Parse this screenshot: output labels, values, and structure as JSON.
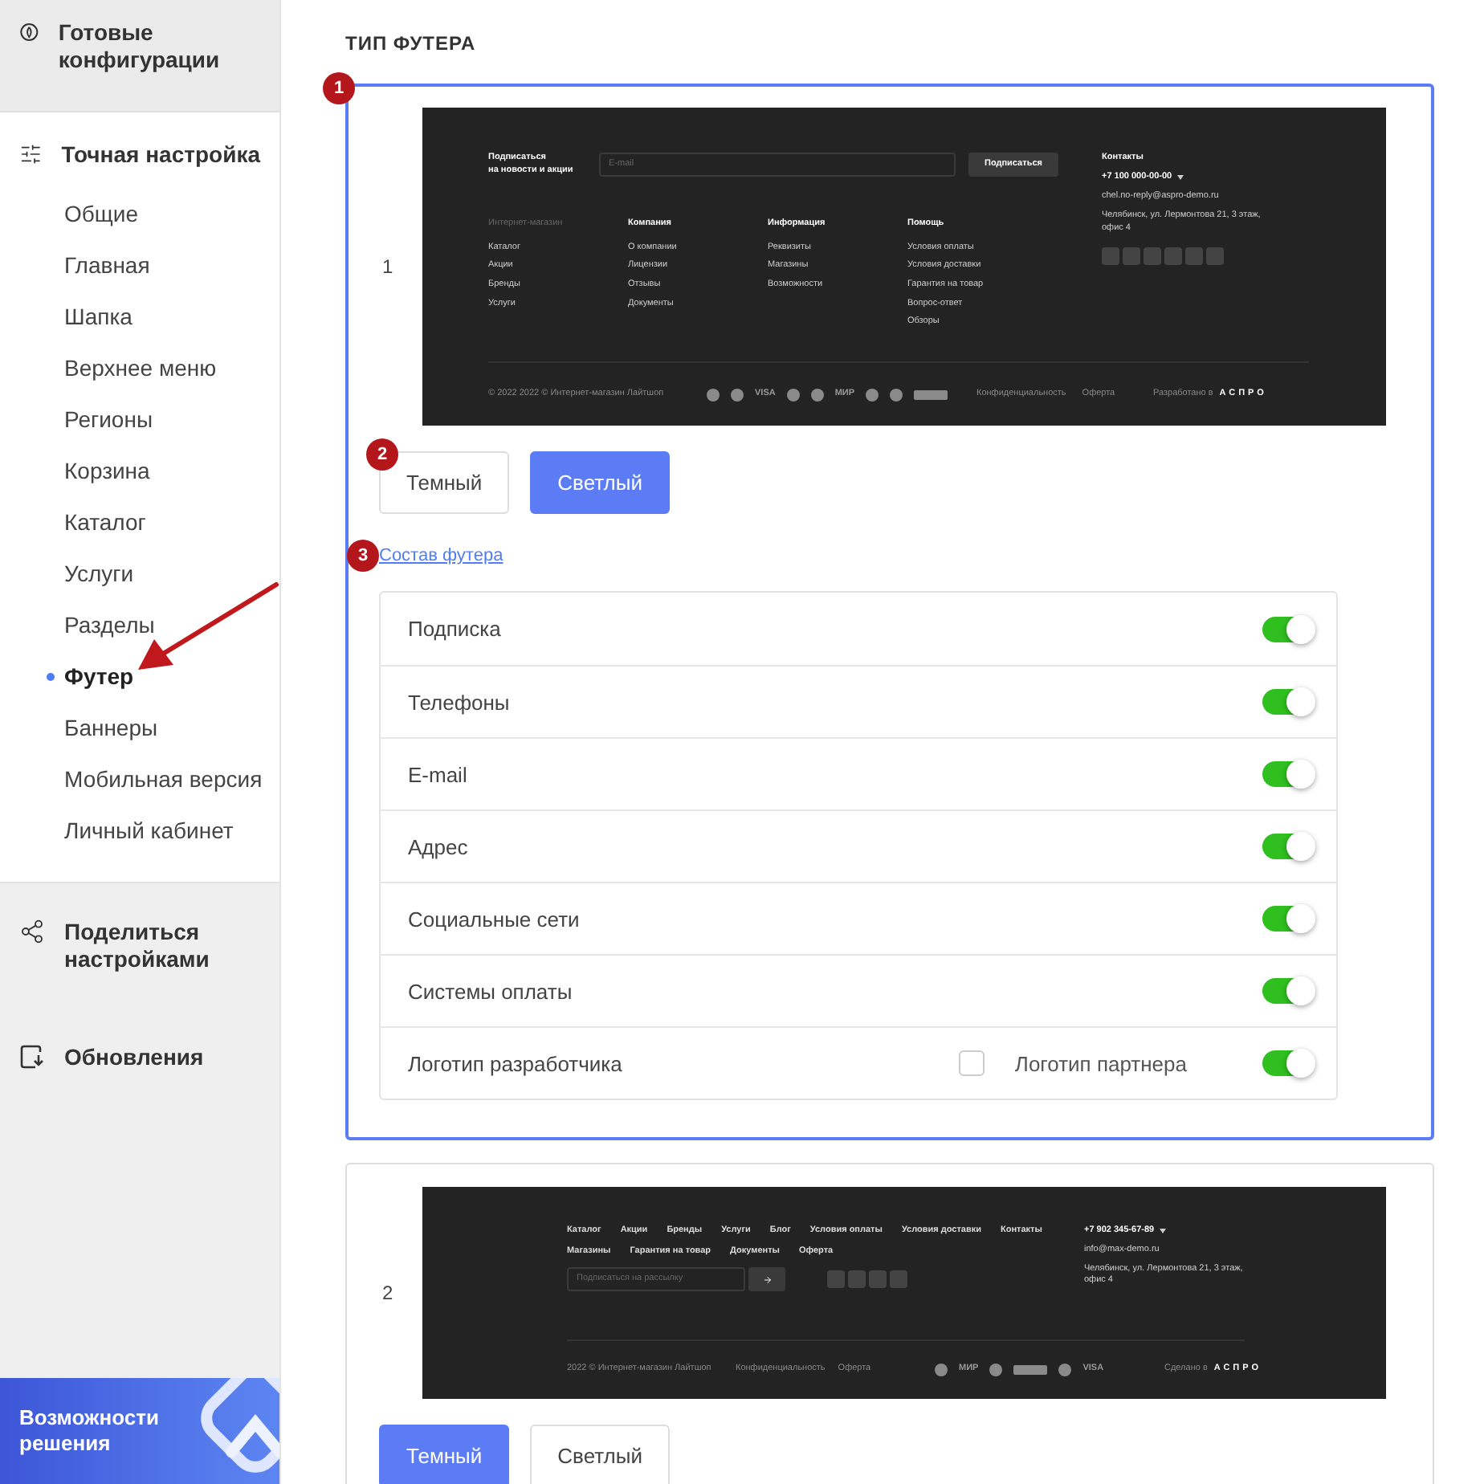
{
  "sidebar": {
    "presets": {
      "label": "Готовые конфигурации"
    },
    "fine_tuning": {
      "label": "Точная настройка",
      "items": [
        {
          "label": "Общие",
          "selected": false
        },
        {
          "label": "Главная",
          "selected": false
        },
        {
          "label": "Шапка",
          "selected": false
        },
        {
          "label": "Верхнее меню",
          "selected": false
        },
        {
          "label": "Регионы",
          "selected": false
        },
        {
          "label": "Корзина",
          "selected": false
        },
        {
          "label": "Каталог",
          "selected": false
        },
        {
          "label": "Услуги",
          "selected": false
        },
        {
          "label": "Разделы",
          "selected": false
        },
        {
          "label": "Футер",
          "selected": true
        },
        {
          "label": "Баннеры",
          "selected": false
        },
        {
          "label": "Мобильная версия",
          "selected": false
        },
        {
          "label": "Личный кабинет",
          "selected": false
        }
      ]
    },
    "share": {
      "label": "Поделиться настройками"
    },
    "updates": {
      "label": "Обновления"
    },
    "promo": {
      "label": "Возможности решения"
    }
  },
  "section_title": "ТИП ФУТЕРА",
  "footer_types": [
    {
      "number": "1",
      "selected": true,
      "badge": "1",
      "theme_badge": "2",
      "link_badge": "3",
      "preview": {
        "kind": "columns",
        "subscribe": {
          "title_lines": [
            "Подписаться",
            "на новости и акции"
          ],
          "placeholder": "E-mail",
          "button": "Подписаться"
        },
        "columns": [
          {
            "title": "Интернет-магазин",
            "muted": true,
            "links": [
              "Каталог",
              "Акции",
              "Бренды",
              "Услуги"
            ]
          },
          {
            "title": "Компания",
            "muted": false,
            "links": [
              "О компании",
              "Лицензии",
              "Отзывы",
              "Документы"
            ]
          },
          {
            "title": "Информация",
            "muted": false,
            "links": [
              "Реквизиты",
              "Магазины",
              "Возможности"
            ]
          },
          {
            "title": "Помощь",
            "muted": false,
            "links": [
              "Условия оплаты",
              "Условия доставки",
              "Гарантия на товар",
              "Вопрос-ответ",
              "Обзоры"
            ]
          }
        ],
        "contacts": {
          "title": "Контакты",
          "phone": "+7 100 000-00-00",
          "email": "chel.no-reply@aspro-demo.ru",
          "address": "Челябинск, ул. Лермонтова 21, 3 этаж, офис 4"
        },
        "copyright": "© 2022 2022 © Интернет-магазин Лайтшоп",
        "payments": [
          {
            "kind": "icon"
          },
          {
            "kind": "icon"
          },
          {
            "kind": "text",
            "label": "VISA"
          },
          {
            "kind": "icon"
          },
          {
            "kind": "icon"
          },
          {
            "kind": "text",
            "label": "МИР"
          },
          {
            "kind": "icon"
          },
          {
            "kind": "icon"
          },
          {
            "kind": "card"
          }
        ],
        "links": [
          "Конфиденциальность",
          "Оферта"
        ],
        "developer": {
          "label": "Разработано в",
          "brand": "АСПРО"
        }
      },
      "themes": [
        {
          "label": "Темный",
          "selected": false
        },
        {
          "label": "Светлый",
          "selected": true
        }
      ],
      "composition_link": "Состав футера",
      "options": [
        {
          "kind": "toggle",
          "label": "Подписка",
          "on": true
        },
        {
          "kind": "toggle",
          "label": "Телефоны",
          "on": true
        },
        {
          "kind": "toggle",
          "label": "E-mail",
          "on": true
        },
        {
          "kind": "toggle",
          "label": "Адрес",
          "on": true
        },
        {
          "kind": "toggle",
          "label": "Социальные сети",
          "on": true
        },
        {
          "kind": "toggle",
          "label": "Системы оплаты",
          "on": true
        },
        {
          "kind": "toggle_partner",
          "label": "Логотип разработчика",
          "partner_label": "Логотип партнера",
          "partner_checked": false,
          "on": true
        }
      ]
    },
    {
      "number": "2",
      "selected": false,
      "preview": {
        "kind": "inline",
        "nav_rows": [
          [
            "Каталог",
            "Акции",
            "Бренды",
            "Услуги",
            "Блог",
            "Условия оплаты",
            "Условия доставки",
            "Контакты"
          ],
          [
            "Магазины",
            "Гарантия на товар",
            "Документы",
            "Оферта"
          ]
        ],
        "subscribe": {
          "placeholder": "Подписаться на рассылку"
        },
        "contacts": {
          "phone": "+7 902 345-67-89",
          "email": "info@max-demo.ru",
          "address": "Челябинск, ул. Лермонтова 21, 3 этаж, офис 4"
        },
        "copyright": "2022 © Интернет-магазин Лайтшоп",
        "links": [
          "Конфиденциальность",
          "Оферта"
        ],
        "payments": [
          {
            "kind": "icon"
          },
          {
            "kind": "text",
            "label": "МИР"
          },
          {
            "kind": "icon"
          },
          {
            "kind": "card"
          },
          {
            "kind": "icon"
          },
          {
            "kind": "text",
            "label": "VISA"
          }
        ],
        "developer": {
          "label": "Сделано в",
          "brand": "АСПРО"
        }
      },
      "themes": [
        {
          "label": "Темный",
          "selected": true
        },
        {
          "label": "Светлый",
          "selected": false
        }
      ]
    }
  ]
}
